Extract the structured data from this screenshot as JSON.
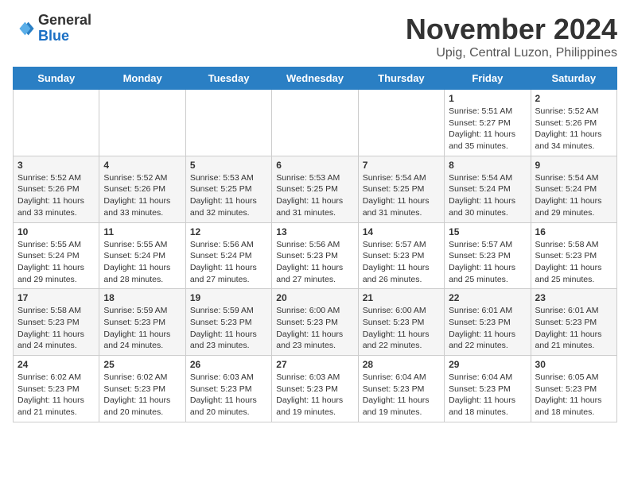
{
  "logo": {
    "general": "General",
    "blue": "Blue"
  },
  "title": "November 2024",
  "subtitle": "Upig, Central Luzon, Philippines",
  "days_header": [
    "Sunday",
    "Monday",
    "Tuesday",
    "Wednesday",
    "Thursday",
    "Friday",
    "Saturday"
  ],
  "weeks": [
    [
      {
        "day": "",
        "info": ""
      },
      {
        "day": "",
        "info": ""
      },
      {
        "day": "",
        "info": ""
      },
      {
        "day": "",
        "info": ""
      },
      {
        "day": "",
        "info": ""
      },
      {
        "day": "1",
        "info": "Sunrise: 5:51 AM\nSunset: 5:27 PM\nDaylight: 11 hours\nand 35 minutes."
      },
      {
        "day": "2",
        "info": "Sunrise: 5:52 AM\nSunset: 5:26 PM\nDaylight: 11 hours\nand 34 minutes."
      }
    ],
    [
      {
        "day": "3",
        "info": "Sunrise: 5:52 AM\nSunset: 5:26 PM\nDaylight: 11 hours\nand 33 minutes."
      },
      {
        "day": "4",
        "info": "Sunrise: 5:52 AM\nSunset: 5:26 PM\nDaylight: 11 hours\nand 33 minutes."
      },
      {
        "day": "5",
        "info": "Sunrise: 5:53 AM\nSunset: 5:25 PM\nDaylight: 11 hours\nand 32 minutes."
      },
      {
        "day": "6",
        "info": "Sunrise: 5:53 AM\nSunset: 5:25 PM\nDaylight: 11 hours\nand 31 minutes."
      },
      {
        "day": "7",
        "info": "Sunrise: 5:54 AM\nSunset: 5:25 PM\nDaylight: 11 hours\nand 31 minutes."
      },
      {
        "day": "8",
        "info": "Sunrise: 5:54 AM\nSunset: 5:24 PM\nDaylight: 11 hours\nand 30 minutes."
      },
      {
        "day": "9",
        "info": "Sunrise: 5:54 AM\nSunset: 5:24 PM\nDaylight: 11 hours\nand 29 minutes."
      }
    ],
    [
      {
        "day": "10",
        "info": "Sunrise: 5:55 AM\nSunset: 5:24 PM\nDaylight: 11 hours\nand 29 minutes."
      },
      {
        "day": "11",
        "info": "Sunrise: 5:55 AM\nSunset: 5:24 PM\nDaylight: 11 hours\nand 28 minutes."
      },
      {
        "day": "12",
        "info": "Sunrise: 5:56 AM\nSunset: 5:24 PM\nDaylight: 11 hours\nand 27 minutes."
      },
      {
        "day": "13",
        "info": "Sunrise: 5:56 AM\nSunset: 5:23 PM\nDaylight: 11 hours\nand 27 minutes."
      },
      {
        "day": "14",
        "info": "Sunrise: 5:57 AM\nSunset: 5:23 PM\nDaylight: 11 hours\nand 26 minutes."
      },
      {
        "day": "15",
        "info": "Sunrise: 5:57 AM\nSunset: 5:23 PM\nDaylight: 11 hours\nand 25 minutes."
      },
      {
        "day": "16",
        "info": "Sunrise: 5:58 AM\nSunset: 5:23 PM\nDaylight: 11 hours\nand 25 minutes."
      }
    ],
    [
      {
        "day": "17",
        "info": "Sunrise: 5:58 AM\nSunset: 5:23 PM\nDaylight: 11 hours\nand 24 minutes."
      },
      {
        "day": "18",
        "info": "Sunrise: 5:59 AM\nSunset: 5:23 PM\nDaylight: 11 hours\nand 24 minutes."
      },
      {
        "day": "19",
        "info": "Sunrise: 5:59 AM\nSunset: 5:23 PM\nDaylight: 11 hours\nand 23 minutes."
      },
      {
        "day": "20",
        "info": "Sunrise: 6:00 AM\nSunset: 5:23 PM\nDaylight: 11 hours\nand 23 minutes."
      },
      {
        "day": "21",
        "info": "Sunrise: 6:00 AM\nSunset: 5:23 PM\nDaylight: 11 hours\nand 22 minutes."
      },
      {
        "day": "22",
        "info": "Sunrise: 6:01 AM\nSunset: 5:23 PM\nDaylight: 11 hours\nand 22 minutes."
      },
      {
        "day": "23",
        "info": "Sunrise: 6:01 AM\nSunset: 5:23 PM\nDaylight: 11 hours\nand 21 minutes."
      }
    ],
    [
      {
        "day": "24",
        "info": "Sunrise: 6:02 AM\nSunset: 5:23 PM\nDaylight: 11 hours\nand 21 minutes."
      },
      {
        "day": "25",
        "info": "Sunrise: 6:02 AM\nSunset: 5:23 PM\nDaylight: 11 hours\nand 20 minutes."
      },
      {
        "day": "26",
        "info": "Sunrise: 6:03 AM\nSunset: 5:23 PM\nDaylight: 11 hours\nand 20 minutes."
      },
      {
        "day": "27",
        "info": "Sunrise: 6:03 AM\nSunset: 5:23 PM\nDaylight: 11 hours\nand 19 minutes."
      },
      {
        "day": "28",
        "info": "Sunrise: 6:04 AM\nSunset: 5:23 PM\nDaylight: 11 hours\nand 19 minutes."
      },
      {
        "day": "29",
        "info": "Sunrise: 6:04 AM\nSunset: 5:23 PM\nDaylight: 11 hours\nand 18 minutes."
      },
      {
        "day": "30",
        "info": "Sunrise: 6:05 AM\nSunset: 5:23 PM\nDaylight: 11 hours\nand 18 minutes."
      }
    ]
  ]
}
